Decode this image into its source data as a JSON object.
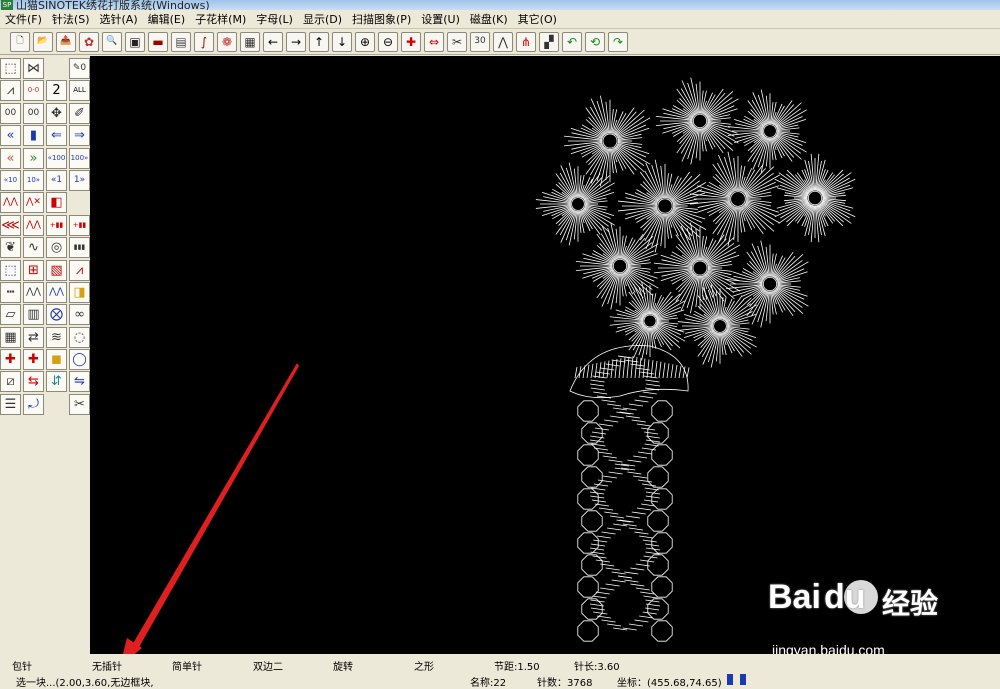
{
  "window": {
    "title": "山猫SINOTEK绣花打版系统(Windows)",
    "app_icon_text": "SP"
  },
  "menu": [
    "文件(F)",
    "针法(S)",
    "选针(A)",
    "编辑(E)",
    "子花样(M)",
    "字母(L)",
    "显示(D)",
    "扫描图象(P)",
    "设置(U)",
    "磁盘(K)",
    "其它(O)"
  ],
  "toolbar_icons": [
    {
      "name": "new-file-icon",
      "glyph": "🗋",
      "color": "#333"
    },
    {
      "name": "open-file-icon",
      "glyph": "📂",
      "color": "#b07020"
    },
    {
      "name": "save-file-icon",
      "glyph": "📤",
      "color": "#c03030"
    },
    {
      "name": "flower-icon",
      "glyph": "✿",
      "color": "#c03030"
    },
    {
      "name": "find-icon",
      "glyph": "🔍",
      "color": "#333"
    },
    {
      "name": "display-icon",
      "glyph": "▣",
      "color": "#222"
    },
    {
      "name": "monitor-icon",
      "glyph": "▬",
      "color": "#900"
    },
    {
      "name": "hatch-icon",
      "glyph": "▤",
      "color": "#444"
    },
    {
      "name": "curve-icon",
      "glyph": "∫",
      "color": "#900"
    },
    {
      "name": "pattern-icon",
      "glyph": "❁",
      "color": "#c03030"
    },
    {
      "name": "stitch-grid-icon",
      "glyph": "▦",
      "color": "#333"
    },
    {
      "name": "arrow-left-icon",
      "glyph": "←",
      "color": "#000"
    },
    {
      "name": "arrow-right-icon",
      "glyph": "→",
      "color": "#000"
    },
    {
      "name": "arrow-up-icon",
      "glyph": "↑",
      "color": "#000"
    },
    {
      "name": "arrow-down-icon",
      "glyph": "↓",
      "color": "#000"
    },
    {
      "name": "zoom-in-icon",
      "glyph": "⊕",
      "color": "#000"
    },
    {
      "name": "zoom-out-icon",
      "glyph": "⊖",
      "color": "#000"
    },
    {
      "name": "cross-add-icon",
      "glyph": "✚",
      "color": "#c00"
    },
    {
      "name": "link-icon",
      "glyph": "⇔",
      "color": "#c00"
    },
    {
      "name": "scissors-icon",
      "glyph": "✂",
      "color": "#333"
    },
    {
      "name": "zoom-30-40-icon",
      "glyph": "30",
      "color": "#333"
    },
    {
      "name": "stitch-tool-icon",
      "glyph": "⋀",
      "color": "#333"
    },
    {
      "name": "stitch-edit-icon",
      "glyph": "⋔",
      "color": "#c00"
    },
    {
      "name": "grid-arrow-icon",
      "glyph": "▞",
      "color": "#333"
    },
    {
      "name": "undo-icon",
      "glyph": "↶",
      "color": "#1a8a1a"
    },
    {
      "name": "all-icon",
      "glyph": "⟲",
      "color": "#1a8a1a"
    },
    {
      "name": "redo-icon",
      "glyph": "↷",
      "color": "#1a8a1a"
    }
  ],
  "left_tools": [
    {
      "name": "select-region-icon",
      "glyph": "⬚",
      "color": "#333"
    },
    {
      "name": "stitch-pick-icon",
      "glyph": "⋈",
      "color": "#333"
    },
    {
      "name": "",
      "glyph": "",
      "color": ""
    },
    {
      "name": "move-stitch-icon",
      "glyph": "✎0",
      "color": "#333"
    },
    {
      "name": "stitch-zigzag-icon",
      "glyph": "⩘",
      "color": "#333"
    },
    {
      "name": "pen-00-icon",
      "glyph": "0-0",
      "color": "#c03030"
    },
    {
      "name": "pen-2-icon",
      "glyph": "2",
      "color": "#000"
    },
    {
      "name": "pen-all-icon",
      "glyph": "ALL",
      "color": "#000"
    },
    {
      "name": "point-00-icon",
      "glyph": "00",
      "color": "#333"
    },
    {
      "name": "point-00b-icon",
      "glyph": "00",
      "color": "#333"
    },
    {
      "name": "point-move-icon",
      "glyph": "✥",
      "color": "#333"
    },
    {
      "name": "point-edit-icon",
      "glyph": "✐",
      "color": "#333"
    },
    {
      "name": "prev-block-icon",
      "glyph": "«",
      "color": "#1a3ab0"
    },
    {
      "name": "block-plus-icon",
      "glyph": "▮",
      "color": "#1a3ab0"
    },
    {
      "name": "prev-10-icon",
      "glyph": "⇐",
      "color": "#1a3ab0"
    },
    {
      "name": "next-10-icon",
      "glyph": "⇒",
      "color": "#1a3ab0"
    },
    {
      "name": "prev-color-icon",
      "glyph": "«",
      "color": "#c05050"
    },
    {
      "name": "next-color-icon",
      "glyph": "»",
      "color": "#2a8a2a"
    },
    {
      "name": "prev-100-icon",
      "glyph": "«100",
      "color": "#1a3ab0"
    },
    {
      "name": "next-100-icon",
      "glyph": "100»",
      "color": "#1a3ab0"
    },
    {
      "name": "prev-10b-icon",
      "glyph": "«10",
      "color": "#1a3ab0"
    },
    {
      "name": "next-10b-icon",
      "glyph": "10»",
      "color": "#1a3ab0"
    },
    {
      "name": "prev-1-icon",
      "glyph": "«1",
      "color": "#1a3ab0"
    },
    {
      "name": "next-1-icon",
      "glyph": "1»",
      "color": "#1a3ab0"
    },
    {
      "name": "satin-icon",
      "glyph": "⋀⋀",
      "color": "#c00"
    },
    {
      "name": "satin-x-icon",
      "glyph": "⋀✕",
      "color": "#c00"
    },
    {
      "name": "red-block-icon",
      "glyph": "◧",
      "color": "#c00"
    },
    {
      "name": "",
      "glyph": "",
      "color": ""
    },
    {
      "name": "fill-tool-icon",
      "glyph": "⋘",
      "color": "#c00"
    },
    {
      "name": "running-stitch-icon",
      "glyph": "⋀⋀",
      "color": "#c00"
    },
    {
      "name": "plus-stitch-icon",
      "glyph": "+▮▮",
      "color": "#c00"
    },
    {
      "name": "plus-stitch-b-icon",
      "glyph": "+▮▮",
      "color": "#c00"
    },
    {
      "name": "leaf-icon",
      "glyph": "❦",
      "color": "#333"
    },
    {
      "name": "curve-tool-icon",
      "glyph": "∿",
      "color": "#333"
    },
    {
      "name": "oval-tool-icon",
      "glyph": "◎",
      "color": "#333"
    },
    {
      "name": "bars-icon",
      "glyph": "▮▮▮",
      "color": "#333"
    },
    {
      "name": "select-cursor-icon",
      "glyph": "⬚",
      "color": "#1a3ab0"
    },
    {
      "name": "center-icon",
      "glyph": "⊞",
      "color": "#c00"
    },
    {
      "name": "satin-fill-icon",
      "glyph": "▧",
      "color": "#c00"
    },
    {
      "name": "zigzag-fill-icon",
      "glyph": "⩘",
      "color": "#c00"
    },
    {
      "name": "dashed-line-icon",
      "glyph": "┅",
      "color": "#333"
    },
    {
      "name": "sawtooth-icon",
      "glyph": "⋀⋀",
      "color": "#333"
    },
    {
      "name": "double-zigzag-icon",
      "glyph": "⋀⋀",
      "color": "#1a3ab0"
    },
    {
      "name": "color-block-icon",
      "glyph": "◨",
      "color": "#d8a010"
    },
    {
      "name": "parallelogram-icon",
      "glyph": "▱",
      "color": "#333"
    },
    {
      "name": "hatch-fill-icon",
      "glyph": "▥",
      "color": "#333"
    },
    {
      "name": "twist-icon",
      "glyph": "⨂",
      "color": "#1a3ab0"
    },
    {
      "name": "rope-icon",
      "glyph": "∞",
      "color": "#333"
    },
    {
      "name": "columns-icon",
      "glyph": "▦",
      "color": "#333"
    },
    {
      "name": "column-arrow-icon",
      "glyph": "⇄",
      "color": "#333"
    },
    {
      "name": "wave-band-icon",
      "glyph": "≋",
      "color": "#333"
    },
    {
      "name": "spiral-icon",
      "glyph": "◌",
      "color": "#333"
    },
    {
      "name": "add-left-icon",
      "glyph": "✚",
      "color": "#c00"
    },
    {
      "name": "add-right-icon",
      "glyph": "✚",
      "color": "#c00"
    },
    {
      "name": "color-squares-icon",
      "glyph": "◼",
      "color": "#d8a010"
    },
    {
      "name": "loop-icon",
      "glyph": "◯",
      "color": "#1a3ab0"
    },
    {
      "name": "diagonal-icon",
      "glyph": "⧄",
      "color": "#333"
    },
    {
      "name": "swap-icon",
      "glyph": "⇆",
      "color": "#c00"
    },
    {
      "name": "color-swap-icon",
      "glyph": "⇵",
      "color": "#1a8a8a"
    },
    {
      "name": "shuffle-icon",
      "glyph": "⇋",
      "color": "#1a3ab0"
    },
    {
      "name": "layers-icon",
      "glyph": "☰",
      "color": "#333"
    },
    {
      "name": "convert-icon",
      "glyph": "⤾",
      "color": "#1a3ab0"
    },
    {
      "name": "",
      "glyph": "",
      "color": ""
    },
    {
      "name": "cut-icon",
      "glyph": "✂",
      "color": "#333"
    }
  ],
  "status": {
    "row1": [
      "包针",
      "无插针",
      "简单针",
      "双边二",
      "旋转",
      "之形",
      "节距:1.50",
      "针长:3.60"
    ],
    "row2_left": "选一块...(2.00,3.60,无边框块,",
    "name_label": "名称:22",
    "stitch_count": "针数：3768",
    "coords": "坐标：(455.68,74.65)"
  },
  "watermark": {
    "brand_a": "Bai",
    "brand_b": "du",
    "brand_cn": "经验",
    "url": "jingyan.baidu.com"
  },
  "colors": {
    "canvas": "#000000",
    "embroidery": "#ffffff",
    "arrow": "#e02020",
    "status_block": "#1a3ab0"
  }
}
